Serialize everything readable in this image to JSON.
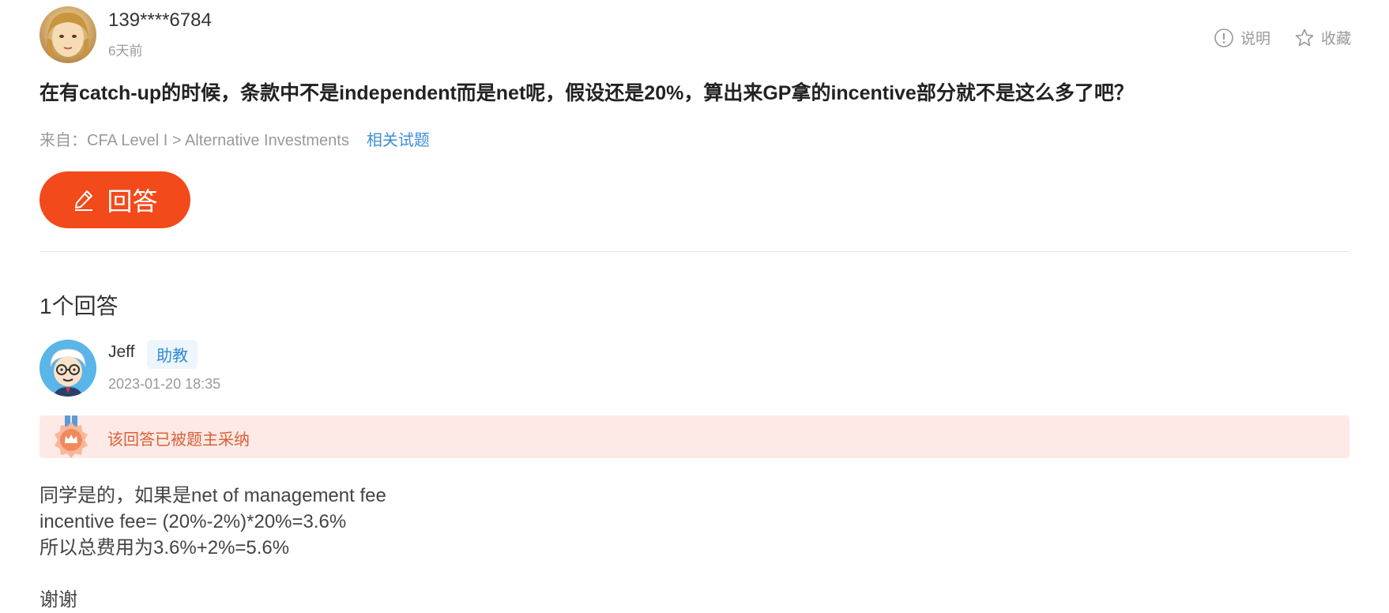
{
  "question": {
    "username": "139****6784",
    "time": "6天前",
    "title": "在有catch-up的时候，条款中不是independent而是net呢，假设还是20%，算出来GP拿的incentive部分就不是这么多了吧？",
    "source": "来自：CFA Level I > Alternative Investments",
    "related_link": "相关试题"
  },
  "actions": {
    "explain_label": "说明",
    "favorite_label": "收藏"
  },
  "answer_button": {
    "label": "回答"
  },
  "answers_section": {
    "count_label": "1个回答"
  },
  "answer": {
    "author": "Jeff",
    "badge": "助教",
    "time": "2023-01-20 18:35",
    "accepted_text": "该回答已被题主采纳",
    "lines": [
      "同学是的，如果是net of management fee",
      "incentive fee= (20%-2%)*20%=3.6%",
      "所以总费用为3.6%+2%=5.6%",
      "",
      "谢谢"
    ]
  },
  "colors": {
    "accent": "#f24a1a",
    "link": "#3d8fd6",
    "accepted_bg": "#fde9e5",
    "accepted_text": "#d9603a"
  }
}
